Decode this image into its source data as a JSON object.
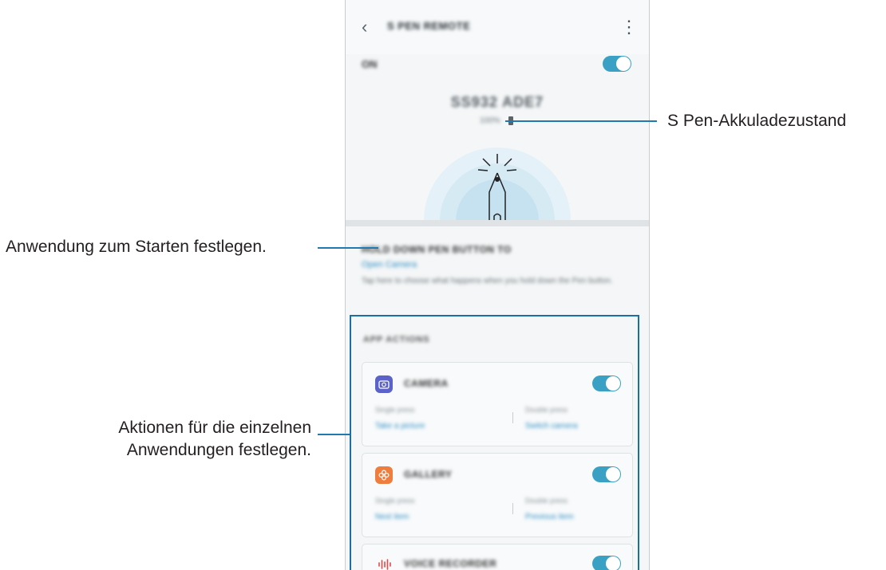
{
  "app": {
    "title": "S PEN REMOTE",
    "master_toggle_label": "ON",
    "master_toggle_on": true
  },
  "pen_status": {
    "device_name": "SS932 ADE7",
    "battery_text": "100%"
  },
  "hold_section": {
    "title": "HOLD DOWN PEN BUTTON TO",
    "value": "Open Camera",
    "description": "Tap here to choose what happens when you hold down the Pen button."
  },
  "app_actions": {
    "title": "APP ACTIONS",
    "cards": [
      {
        "name": "CAMERA",
        "icon": "camera-icon",
        "icon_color": "#5b63c9",
        "enabled": true,
        "single_label": "Single press",
        "single_value": "Take a picture",
        "double_label": "Double press",
        "double_value": "Switch camera"
      },
      {
        "name": "GALLERY",
        "icon": "gallery-flower-icon",
        "icon_color": "#ee7d3e",
        "enabled": true,
        "single_label": "Single press",
        "single_value": "Next item",
        "double_label": "Double press",
        "double_value": "Previous item"
      },
      {
        "name": "VOICE RECORDER",
        "icon": "voice-recorder-icon",
        "icon_color": "#e24a4a",
        "enabled": true
      }
    ]
  },
  "callouts": {
    "battery": "S Pen-Akkuladezustand",
    "app_launch": "Anwendung zum Starten festlegen.",
    "app_actions_line1": "Aktionen für die einzelnen",
    "app_actions_line2": "Anwendungen festlegen."
  },
  "colors": {
    "accent": "#3aa0c4",
    "link": "#2d8fc4",
    "callout_line": "#2079b0"
  }
}
